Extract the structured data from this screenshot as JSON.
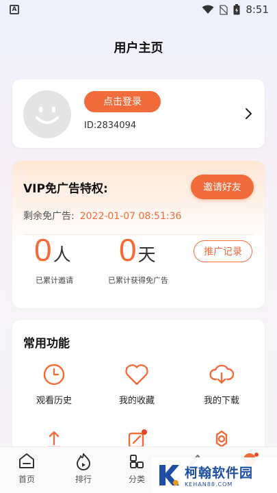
{
  "status_bar": {
    "left_icon_glyph": "A",
    "time": "8:51",
    "icons": [
      "app-notification-icon",
      "wifi-icon",
      "no-sim-icon",
      "battery-icon"
    ]
  },
  "header": {
    "title": "用户主页"
  },
  "profile": {
    "login_label": "点击登录",
    "user_id": "ID:2834094"
  },
  "vip": {
    "title": "VIP免广告特权:",
    "invite_label": "邀请好友",
    "remain_label": "剩余免广告:",
    "remain_date": "2022-01-07 08:51:36",
    "people_count": "0",
    "people_unit": "人",
    "people_label": "已累计邀请",
    "days_count": "0",
    "days_unit": "天",
    "days_label": "已累计获得免广告",
    "promo_label": "推广记录"
  },
  "functions": {
    "title": "常用功能",
    "items": [
      {
        "label": "观看历史",
        "icon": "history-clock-icon"
      },
      {
        "label": "我的收藏",
        "icon": "heart-icon"
      },
      {
        "label": "我的下载",
        "icon": "cloud-download-icon"
      }
    ],
    "row2_icons": [
      "upload-icon",
      "edit-icon",
      "settings-icon"
    ]
  },
  "tabbar": {
    "items": [
      {
        "label": "首页",
        "icon": "home-icon"
      },
      {
        "label": "排行",
        "icon": "flame-icon"
      },
      {
        "label": "分类",
        "icon": "category-icon"
      },
      {
        "label": "",
        "icon": "rocket-icon"
      },
      {
        "label": "",
        "icon": "profile-icon"
      }
    ]
  },
  "watermark": {
    "brand": "柯翰软件园",
    "site": "KEHAN88.COM"
  },
  "colors": {
    "accent": "#f26b3a",
    "watermark": "#1f4fa3"
  }
}
